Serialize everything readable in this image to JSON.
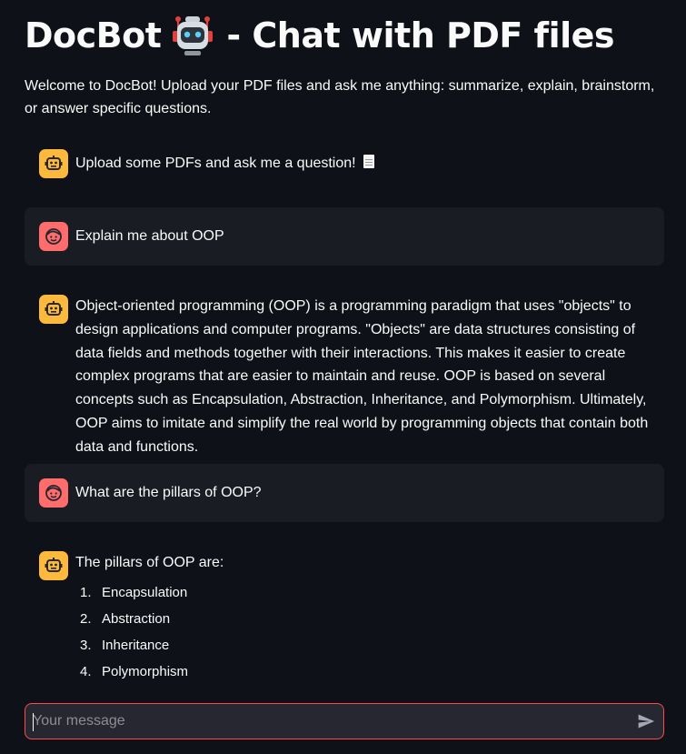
{
  "header": {
    "title_part1": "DocBot",
    "title_part2": "- Chat with PDF files",
    "welcome": "Welcome to DocBot! Upload your PDF files and ask me anything: summarize, explain, brainstorm, or answer specific questions."
  },
  "messages": [
    {
      "role": "assistant",
      "text": "Upload some PDFs and ask me a question!"
    },
    {
      "role": "user",
      "text": "Explain me about OOP"
    },
    {
      "role": "assistant",
      "text": "Object-oriented programming (OOP) is a programming paradigm that uses \"objects\" to design applications and computer programs. \"Objects\" are data structures consisting of data fields and methods together with their interactions. This makes it easier to create complex programs that are easier to maintain and reuse. OOP is based on several concepts such as Encapsulation, Abstraction, Inheritance, and Polymorphism. Ultimately, OOP aims to imitate and simplify the real world by programming objects that contain both data and functions."
    },
    {
      "role": "user",
      "text": "What are the pillars of OOP?"
    },
    {
      "role": "assistant",
      "text": "The pillars of OOP are:",
      "list": [
        {
          "num": "1.",
          "label": "Encapsulation"
        },
        {
          "num": "2.",
          "label": "Abstraction"
        },
        {
          "num": "3.",
          "label": "Inheritance"
        },
        {
          "num": "4.",
          "label": "Polymorphism"
        }
      ]
    }
  ],
  "chat_input": {
    "placeholder": "Your message",
    "value": ""
  },
  "icons": {
    "title": "robot-icon",
    "assistant_avatar": "robot-icon",
    "user_avatar": "smiley-icon",
    "document": "page-icon",
    "send": "send-icon"
  },
  "colors": {
    "background": "#0e1117",
    "user_bubble": "#1a1c24",
    "assistant_avatar": "#fdb93c",
    "user_avatar": "#ff6c6c",
    "input_border": "#ff4b4b"
  }
}
